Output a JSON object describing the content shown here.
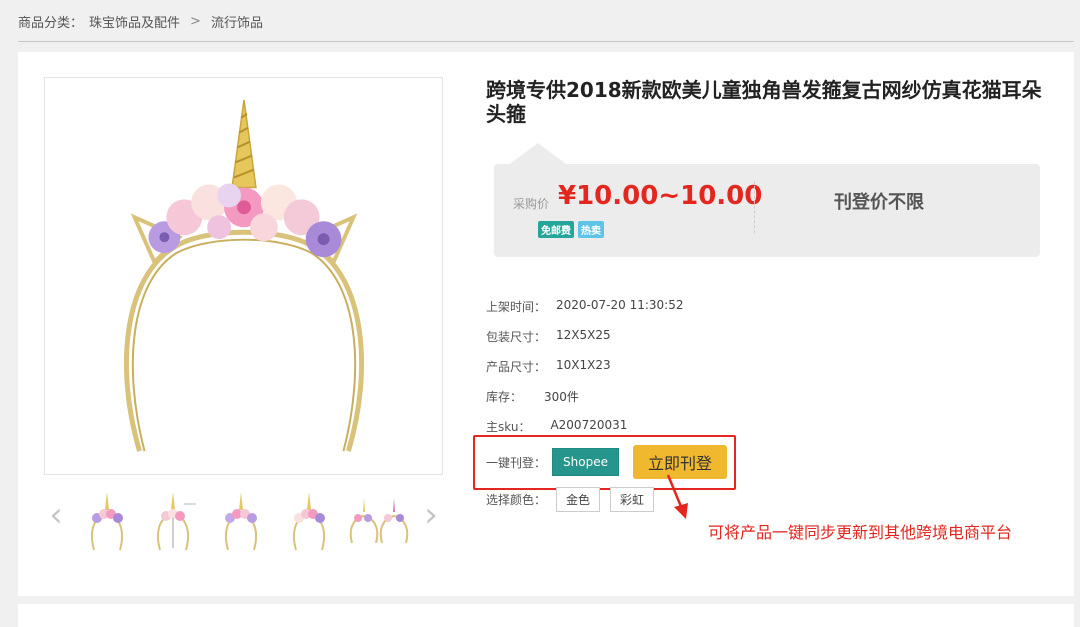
{
  "breadcrumb": {
    "label": "商品分类：",
    "level1": "珠宝饰品及配件",
    "separator": ">",
    "level2": "流行饰品"
  },
  "product": {
    "title": "跨境专供2018新款欧美儿童独角兽发箍复古网纱仿真花猫耳朵头箍",
    "price_label": "采购价",
    "price": "¥10.00~10.00",
    "badges": [
      "免邮费",
      "热卖"
    ],
    "listing_price": "刊登价不限",
    "info": [
      {
        "label": "上架时间：",
        "value": "2020-07-20 11:30:52"
      },
      {
        "label": "包装尺寸：",
        "value": "12X5X25"
      },
      {
        "label": "产品尺寸：",
        "value": "10X1X23"
      },
      {
        "label": "库存：",
        "value": "300件"
      },
      {
        "label": "主sku：",
        "value": "A200720031"
      }
    ],
    "sync_label": "一键刊登：",
    "platform": "Shopee",
    "publish_button": "立即刊登",
    "color_label": "选择颜色：",
    "colors": [
      "金色",
      "彩虹"
    ]
  },
  "gallery": {
    "prev_arrow": "‹",
    "next_arrow": "›",
    "thumb_count": 6
  },
  "annotation": {
    "text": "可将产品一键同步更新到其他跨境电商平台",
    "color": "#e3261e"
  },
  "colors": {
    "price_red": "#e3261e",
    "shopee_teal": "#26968c",
    "publish_yellow": "#f0b82f"
  }
}
